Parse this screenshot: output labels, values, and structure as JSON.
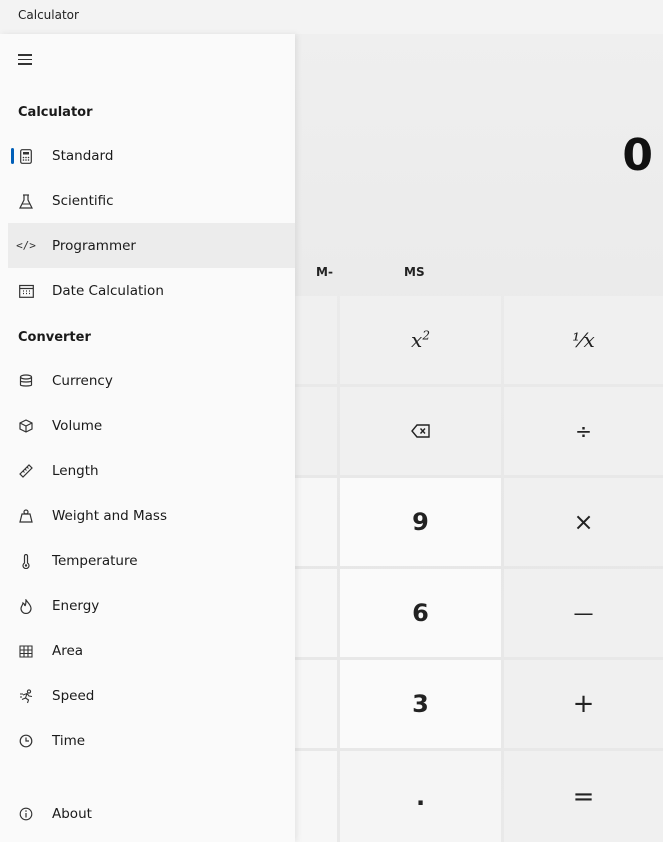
{
  "window": {
    "title": "Calculator"
  },
  "display": {
    "value": "0"
  },
  "memory": {
    "m_minus": "M-",
    "ms": "MS"
  },
  "keys": {
    "x_squared": "x",
    "x_squared_sup": "2",
    "reciprocal": "⅟x",
    "backspace_icon": "backspace-icon",
    "divide": "÷",
    "nine": "9",
    "multiply": "×",
    "six": "6",
    "subtract": "—",
    "three": "3",
    "add": "+",
    "decimal": ".",
    "equals": "="
  },
  "nav": {
    "calculator_header": "Calculator",
    "converter_header": "Converter",
    "items": [
      {
        "label": "Standard",
        "icon": "calculator-icon"
      },
      {
        "label": "Scientific",
        "icon": "flask-icon"
      },
      {
        "label": "Programmer",
        "icon": "code-icon"
      },
      {
        "label": "Date Calculation",
        "icon": "calendar-icon"
      },
      {
        "label": "Currency",
        "icon": "currency-icon"
      },
      {
        "label": "Volume",
        "icon": "cube-icon"
      },
      {
        "label": "Length",
        "icon": "ruler-icon"
      },
      {
        "label": "Weight and Mass",
        "icon": "weight-icon"
      },
      {
        "label": "Temperature",
        "icon": "thermometer-icon"
      },
      {
        "label": "Energy",
        "icon": "flame-icon"
      },
      {
        "label": "Area",
        "icon": "area-grid-icon"
      },
      {
        "label": "Speed",
        "icon": "runner-icon"
      },
      {
        "label": "Time",
        "icon": "clock-icon"
      },
      {
        "label": "About",
        "icon": "info-icon"
      }
    ],
    "selected": "Standard"
  },
  "colors": {
    "accent": "#005fb8"
  }
}
